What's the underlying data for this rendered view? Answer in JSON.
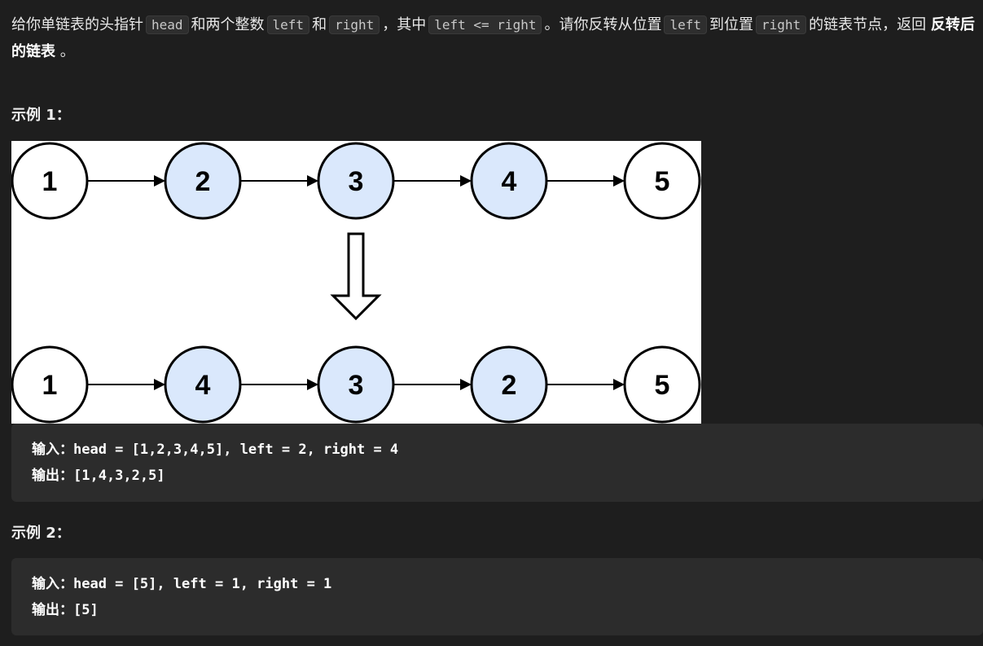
{
  "description": {
    "t1": "给你单链表的头指针",
    "c_head": "head",
    "t2": "和两个整数",
    "c_left": "left",
    "t3": "和",
    "c_right": "right",
    "t4": "，其中",
    "c_cond": "left <= right",
    "t5": "。请你反转从位置",
    "c_left2": "left",
    "t6": "到位置",
    "c_right2": "right",
    "t7": "的链表节点，返回",
    "bold": "反转后的链表",
    "t8": "。"
  },
  "examples": [
    {
      "title": "示例 1：",
      "input_label": "输入：",
      "input_value": "head = [1,2,3,4,5], left = 2, right = 4",
      "output_label": "输出：",
      "output_value": "[1,4,3,2,5]"
    },
    {
      "title": "示例 2：",
      "input_label": "输入：",
      "input_value": "head = [5], left = 1, right = 1",
      "output_label": "输出：",
      "output_value": "[5]"
    }
  ],
  "diagram": {
    "before": [
      {
        "label": "1",
        "highlight": false
      },
      {
        "label": "2",
        "highlight": true
      },
      {
        "label": "3",
        "highlight": true
      },
      {
        "label": "4",
        "highlight": true
      },
      {
        "label": "5",
        "highlight": false
      }
    ],
    "after": [
      {
        "label": "1",
        "highlight": false
      },
      {
        "label": "4",
        "highlight": true
      },
      {
        "label": "3",
        "highlight": true
      },
      {
        "label": "2",
        "highlight": true
      },
      {
        "label": "5",
        "highlight": false
      }
    ],
    "colors": {
      "highlight_fill": "#dae8fc",
      "plain_fill": "#ffffff",
      "stroke": "#000000"
    }
  }
}
